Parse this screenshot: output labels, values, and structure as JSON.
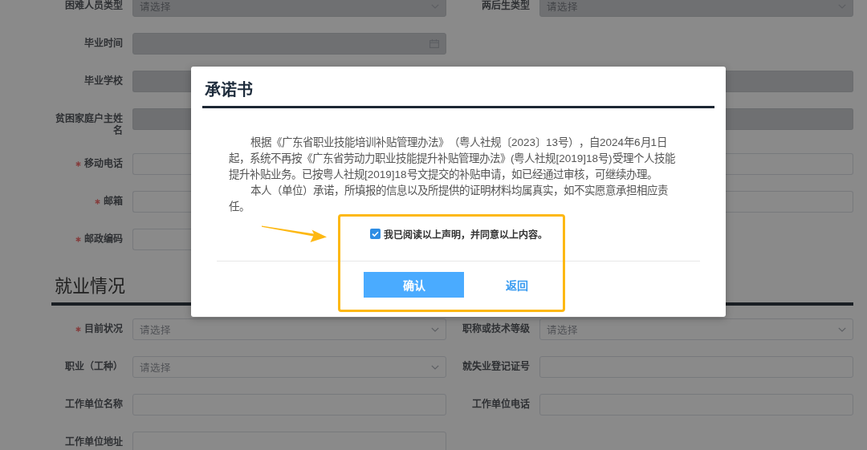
{
  "form": {
    "rows": [
      {
        "left": {
          "label": "困难人员类型",
          "kind": "select",
          "placeholder": "请选择",
          "required": false,
          "disabled": true
        },
        "right": {
          "label": "两后生类型",
          "kind": "select",
          "placeholder": "请选择",
          "required": false,
          "disabled": true
        }
      },
      {
        "left": {
          "label": "毕业时间",
          "kind": "date",
          "required": false,
          "disabled": true
        }
      },
      {
        "left": {
          "label": "毕业学校",
          "kind": "text",
          "required": false,
          "disabled": true
        },
        "right": {
          "kind": "text",
          "disabled": true
        }
      },
      {
        "left": {
          "label": "贫困家庭户主姓名",
          "kind": "text",
          "required": false,
          "disabled": true
        },
        "right": {
          "kind": "text",
          "disabled": true
        }
      },
      {
        "left": {
          "label": "移动电话",
          "kind": "text",
          "required": true,
          "disabled": false
        },
        "right": {
          "kind": "text",
          "disabled": false
        }
      },
      {
        "left": {
          "label": "邮箱",
          "kind": "text",
          "required": true,
          "disabled": false
        },
        "right": {
          "kind": "text",
          "disabled": false
        }
      },
      {
        "left": {
          "label": "邮政编码",
          "kind": "text",
          "required": true,
          "disabled": false
        }
      }
    ]
  },
  "employment": {
    "title": "就业情况",
    "rows": [
      {
        "left": {
          "label": "目前状况",
          "kind": "select",
          "placeholder": "请选择",
          "required": true,
          "disabled": false
        },
        "right": {
          "label": "职称或技术等级",
          "kind": "select",
          "placeholder": "请选择",
          "required": false,
          "disabled": false
        }
      },
      {
        "left": {
          "label": "职业（工种）",
          "kind": "select",
          "placeholder": "请选择",
          "required": false,
          "disabled": false
        },
        "right": {
          "label": "就失业登记证号",
          "kind": "text",
          "required": false,
          "disabled": false
        }
      },
      {
        "left": {
          "label": "工作单位名称",
          "kind": "text",
          "required": false,
          "disabled": false
        },
        "right": {
          "label": "工作单位电话",
          "kind": "text",
          "required": false,
          "disabled": false
        }
      },
      {
        "left": {
          "label": "工作单位地址",
          "kind": "text",
          "required": false,
          "disabled": false
        }
      }
    ]
  },
  "modal": {
    "title": "承诺书",
    "paragraphs": [
      "根据《广东省职业技能培训补贴管理办法》（粤人社规〔2023〕13号），自2024年6月1日起，系统不再按《广东省劳动力职业技能提升补贴管理办法》(粤人社规[2019]18号)受理个人技能提升补贴业务。已按粤人社规[2019]18号文提交的补贴申请，如已经通过审核，可继续办理。",
      "本人（单位）承诺，所填报的信息以及所提供的证明材料均属真实，如不实愿意承担相应责任。"
    ],
    "agreement": {
      "label": "我已阅读以上声明，并同意以上内容。",
      "checked": true
    },
    "buttons": [
      {
        "label": "确认",
        "kind": "primary"
      },
      {
        "label": "返回",
        "kind": "link"
      }
    ],
    "highlighted": true
  }
}
